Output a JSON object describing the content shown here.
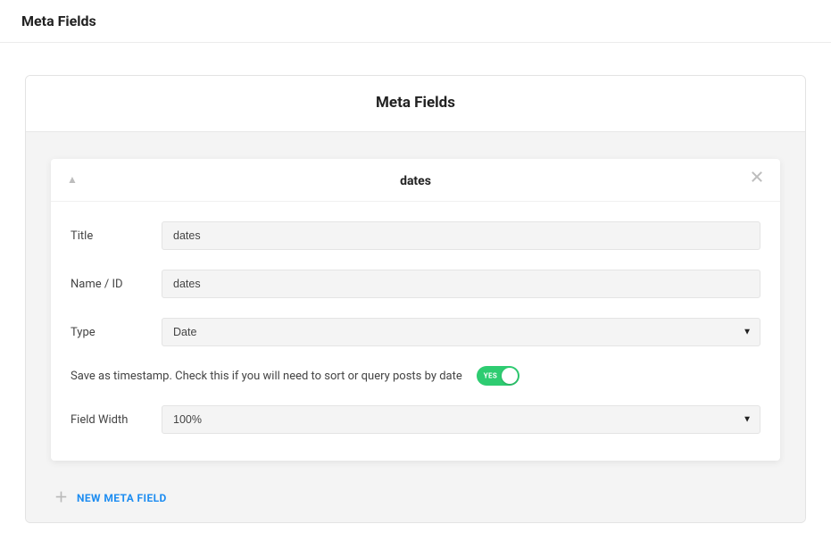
{
  "top": {
    "title": "Meta Fields"
  },
  "panel": {
    "title": "Meta Fields"
  },
  "card": {
    "title": "dates",
    "fields": {
      "title_label": "Title",
      "title_value": "dates",
      "name_label": "Name / ID",
      "name_value": "dates",
      "type_label": "Type",
      "type_value": "Date",
      "timestamp_text": "Save as timestamp. Check this if you will need to sort or query posts by date",
      "toggle_on_label": "YES",
      "width_label": "Field Width",
      "width_value": "100%"
    }
  },
  "actions": {
    "new_field": "NEW META FIELD"
  }
}
